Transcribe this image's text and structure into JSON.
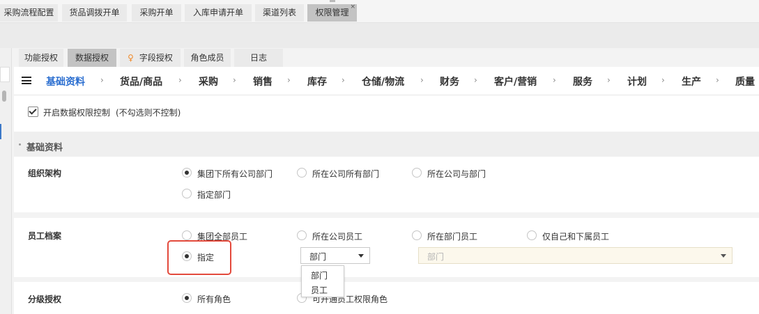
{
  "top_tabs": [
    {
      "label": "采购流程配置",
      "active": false
    },
    {
      "label": "货品调拨开单",
      "active": false
    },
    {
      "label": "采购开单",
      "active": false
    },
    {
      "label": "入库申请开单",
      "active": false
    },
    {
      "label": "渠道列表",
      "active": false
    },
    {
      "label": "权限管理",
      "active": true,
      "close": "×"
    }
  ],
  "sub_tabs": [
    {
      "label": "功能授权",
      "active": false
    },
    {
      "label": "数据授权",
      "active": true
    },
    {
      "label": "字段授权",
      "active": false,
      "icon": "lightbulb-icon"
    },
    {
      "label": "角色成员",
      "active": false
    },
    {
      "label": "日志",
      "active": false
    }
  ],
  "module_nav": {
    "items": [
      {
        "label": "基础资料",
        "active": true
      },
      {
        "label": "货品/商品"
      },
      {
        "label": "采购"
      },
      {
        "label": "销售"
      },
      {
        "label": "库存"
      },
      {
        "label": "仓储/物流"
      },
      {
        "label": "财务"
      },
      {
        "label": "客户/营销"
      },
      {
        "label": "服务"
      },
      {
        "label": "计划"
      },
      {
        "label": "生产"
      },
      {
        "label": "质量"
      }
    ],
    "separator": "›"
  },
  "enable_control": {
    "label": "开启数据权限控制",
    "hint": "(不勾选则不控制)",
    "checked": true
  },
  "section_title": "基础资料",
  "org": {
    "label": "组织架构",
    "options": [
      "集团下所有公司部门",
      "所在公司所有部门",
      "所在公司与部门",
      "指定部门"
    ],
    "selected": 0
  },
  "employee": {
    "label": "员工档案",
    "options": [
      "集团全部员工",
      "所在公司员工",
      "所在部门员工",
      "仅自己和下属员工",
      "指定"
    ],
    "selected": 4,
    "type_select": "部门",
    "value_select_placeholder": "部门",
    "dropdown_options": [
      "部门",
      "员工"
    ]
  },
  "grading": {
    "label": "分级授权",
    "options": [
      "所有角色",
      "可开通员工权限角色"
    ],
    "selected": 0
  },
  "colors": {
    "accent": "#2c6fd0",
    "highlight_box": "#e34a3c"
  }
}
